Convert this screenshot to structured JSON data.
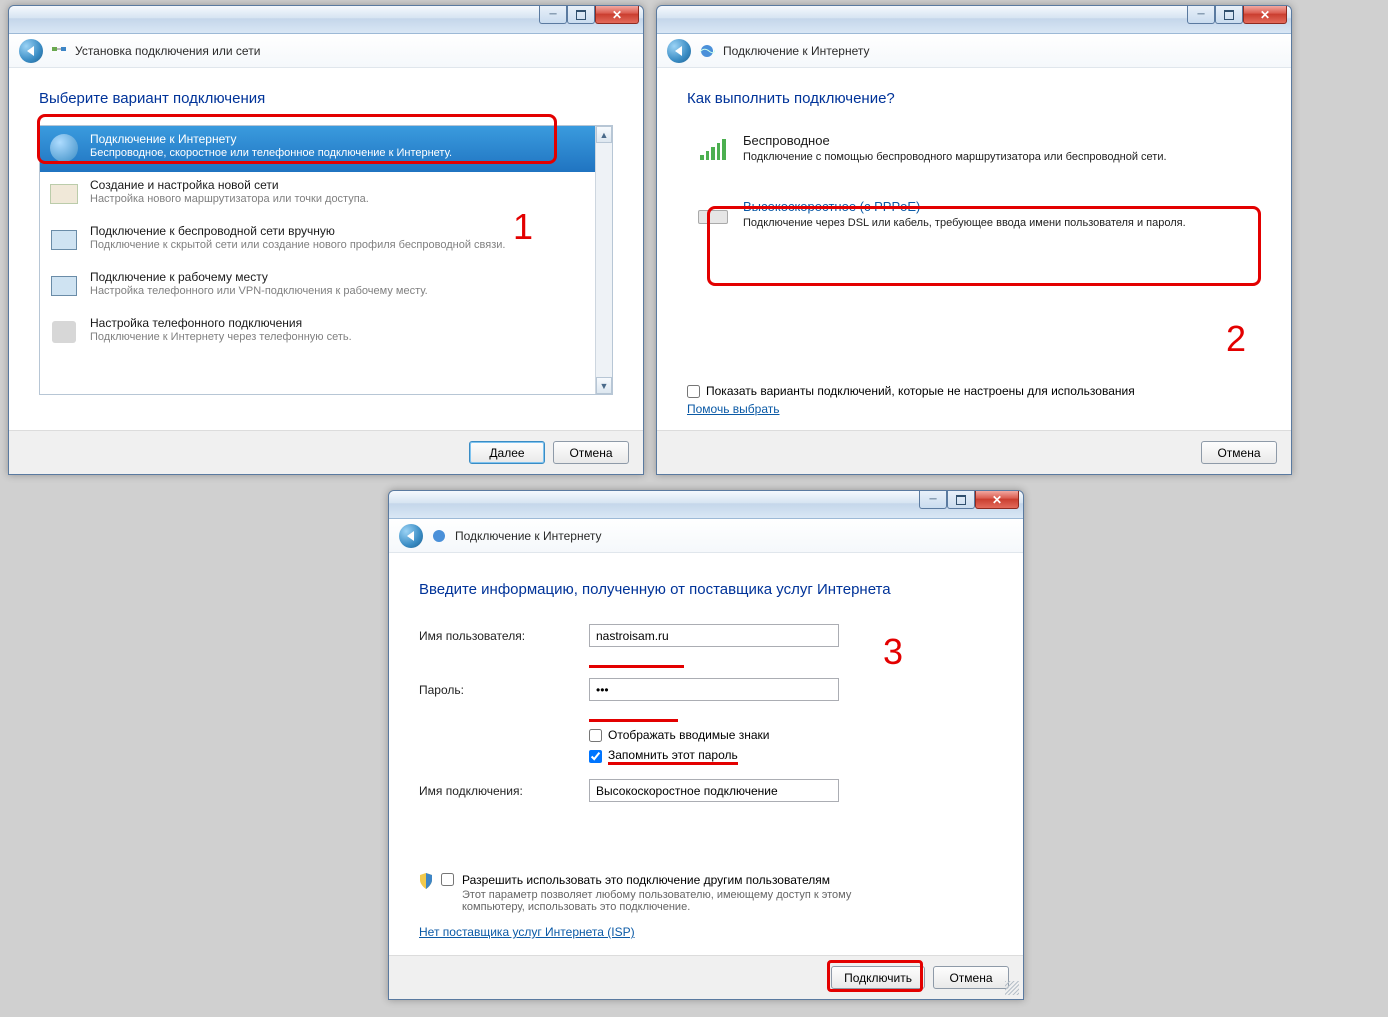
{
  "win1": {
    "subtitle": "Установка подключения или сети",
    "heading": "Выберите вариант подключения",
    "options": [
      {
        "title": "Подключение к Интернету",
        "desc": "Беспроводное, скоростное или телефонное подключение к Интернету."
      },
      {
        "title": "Создание и настройка новой сети",
        "desc": "Настройка нового маршрутизатора или точки доступа."
      },
      {
        "title": "Подключение к беспроводной сети вручную",
        "desc": "Подключение к скрытой сети или создание нового профиля беспроводной связи."
      },
      {
        "title": "Подключение к рабочему месту",
        "desc": "Настройка телефонного или VPN-подключения к рабочему месту."
      },
      {
        "title": "Настройка телефонного подключения",
        "desc": "Подключение к Интернету через телефонную сеть."
      }
    ],
    "next": "Далее",
    "cancel": "Отмена",
    "annot": "1"
  },
  "win2": {
    "subtitle": "Подключение к Интернету",
    "heading": "Как выполнить подключение?",
    "opt_wireless": {
      "title": "Беспроводное",
      "desc": "Подключение с помощью беспроводного маршрутизатора или беспроводной сети."
    },
    "opt_pppoe": {
      "title": "Высокоскоростное (с PPPoE)",
      "desc": "Подключение через DSL или кабель, требующее ввода имени пользователя и пароля."
    },
    "show_opts": "Показать варианты подключений, которые не настроены для использования",
    "help": "Помочь выбрать",
    "cancel": "Отмена",
    "annot": "2"
  },
  "win3": {
    "subtitle": "Подключение к Интернету",
    "heading": "Введите информацию, полученную от поставщика услуг Интернета",
    "user_label": "Имя пользователя:",
    "user_value": "nastroisam.ru",
    "pass_label": "Пароль:",
    "pass_value": "•••",
    "show_chars": "Отображать вводимые знаки",
    "remember": "Запомнить этот пароль",
    "conn_label": "Имя подключения:",
    "conn_value": "Высокоскоростное подключение",
    "allow": "Разрешить использовать это подключение другим пользователям",
    "allow_desc": "Этот параметр позволяет любому пользователю, имеющему доступ к этому компьютеру, использовать это подключение.",
    "noisp": "Нет поставщика услуг Интернета (ISP)",
    "connect": "Подключить",
    "cancel": "Отмена",
    "annot": "3"
  }
}
